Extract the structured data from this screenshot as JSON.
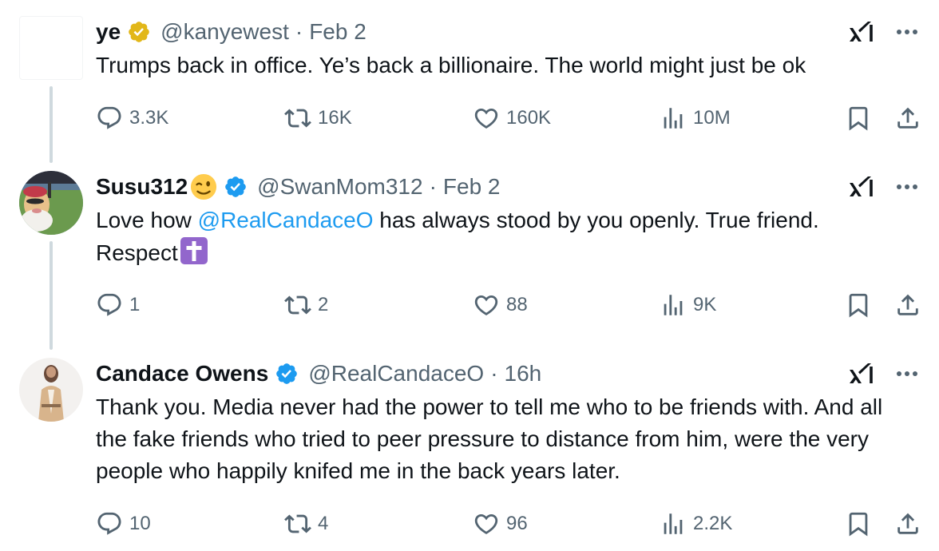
{
  "tweets": [
    {
      "name": "ye",
      "verified": "gold-check-badge",
      "handle": "@kanyewest",
      "separator": "·",
      "time": "Feb 2",
      "text": "Trumps back in office. Ye’s back a billionaire. The world might just be ok",
      "counts": {
        "replies": "3.3K",
        "reposts": "16K",
        "likes": "160K",
        "views": "10M"
      }
    },
    {
      "name": "Susu312",
      "name_emoji": "winking-face-emoji",
      "verified": "blue-check-badge",
      "handle": "@SwanMom312",
      "separator": "·",
      "time": "Feb 2",
      "text_before": "Love how ",
      "mention": "@RealCandaceO",
      "text_after": " has always stood by you openly. True friend. Respect",
      "text_emoji": "latin-cross-emoji",
      "counts": {
        "replies": "1",
        "reposts": "2",
        "likes": "88",
        "views": "9K"
      }
    },
    {
      "name": "Candace Owens",
      "verified": "blue-check-badge",
      "handle": "@RealCandaceO",
      "separator": "·",
      "time": "16h",
      "text": "Thank you. Media never had the power to tell me who to be friends with. And all the fake friends who tried to peer pressure to distance from him, were the very people who happily knifed me in the back years later.",
      "counts": {
        "replies": "10",
        "reposts": "4",
        "likes": "96",
        "views": "2.2K"
      }
    }
  ],
  "colors": {
    "text": "#0f1419",
    "secondary": "#536471",
    "mention": "#1d9bf0",
    "thread_line": "#cfd9de",
    "gold_badge": "#e2b719",
    "blue_badge": "#1d9bf0"
  }
}
